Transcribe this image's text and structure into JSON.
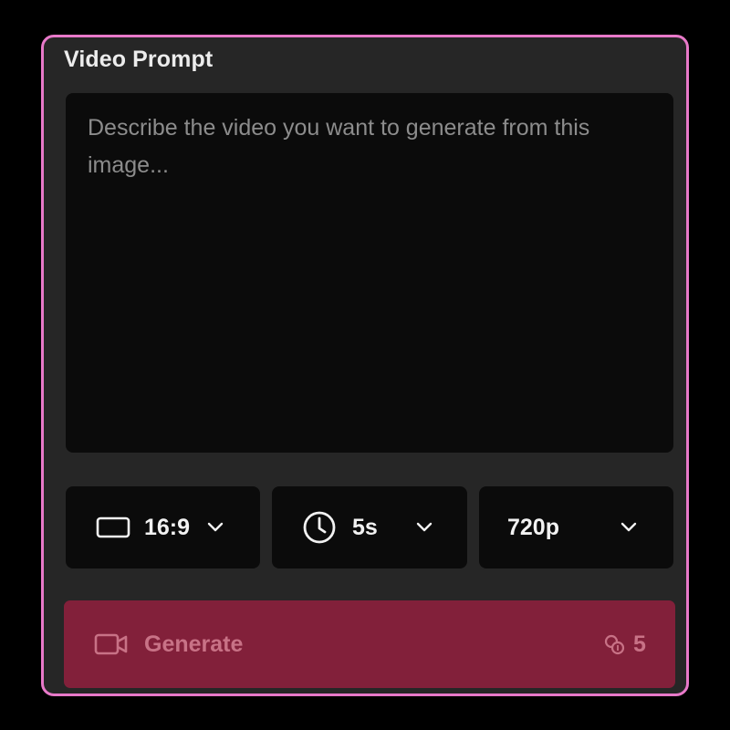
{
  "panel": {
    "title": "Video Prompt"
  },
  "prompt": {
    "value": "",
    "placeholder": "Describe the video you want to generate from this image..."
  },
  "options": {
    "aspect_ratio": {
      "value": "16:9",
      "icon": "aspect-ratio-icon"
    },
    "duration": {
      "value": "5s",
      "icon": "clock-icon"
    },
    "resolution": {
      "value": "720p"
    }
  },
  "generate": {
    "label": "Generate",
    "icon": "video-camera-icon",
    "credit_icon": "coins-icon",
    "cost": "5"
  },
  "colors": {
    "accent_border": "#e879c9",
    "generate_bg": "#82203a",
    "generate_text": "#c87286",
    "panel_bg": "#262626",
    "field_bg": "#0b0b0b"
  }
}
